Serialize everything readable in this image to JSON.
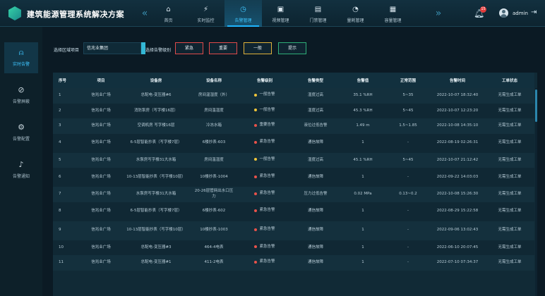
{
  "app": {
    "title": "建筑能源管理系统解决方案"
  },
  "nav": {
    "prev_icon": "double-chevron-left-icon",
    "next_icon": "double-chevron-right-icon",
    "items": [
      {
        "label": "首页",
        "icon": "home-icon",
        "glyph": "⌂",
        "active": false
      },
      {
        "label": "实时监控",
        "icon": "pulse-icon",
        "glyph": "⚡",
        "active": false
      },
      {
        "label": "告警管理",
        "icon": "alarm-icon",
        "glyph": "◷",
        "active": true
      },
      {
        "label": "视频管理",
        "icon": "video-icon",
        "glyph": "▣",
        "active": false
      },
      {
        "label": "门禁管理",
        "icon": "door-icon",
        "glyph": "▤",
        "active": false
      },
      {
        "label": "量耗管理",
        "icon": "gauge-icon",
        "glyph": "◔",
        "active": false
      },
      {
        "label": "容量管理",
        "icon": "calendar-icon",
        "glyph": "▦",
        "active": false
      }
    ]
  },
  "header": {
    "notification_count": "15",
    "user_name": "admin"
  },
  "sidebar": {
    "items": [
      {
        "label": "实时告警",
        "icon": "alarm-bell-icon",
        "glyph": "⍝",
        "active": true
      },
      {
        "label": "告警屏蔽",
        "icon": "shield-mute-icon",
        "glyph": "⊘",
        "active": false
      },
      {
        "label": "告警配置",
        "icon": "settings-icon",
        "glyph": "⚙",
        "active": false
      },
      {
        "label": "告警通知",
        "icon": "speaker-icon",
        "glyph": "♪",
        "active": false
      }
    ]
  },
  "filters": {
    "area_label": "选择区域项目",
    "area_value": "信兆业集团",
    "level_label": "选择告警级别",
    "levels": [
      {
        "label": "紧急",
        "color": "#e04a4a"
      },
      {
        "label": "重要",
        "color": "#e04a4a"
      },
      {
        "label": "一般",
        "color": "#e0b23a"
      },
      {
        "label": "提示",
        "color": "#2fae78"
      }
    ]
  },
  "table": {
    "headers": [
      "序号",
      "项目",
      "设备房",
      "设备名称",
      "告警级别",
      "告警类型",
      "告警值",
      "正常范围",
      "告警时间",
      "工单状态"
    ],
    "rows": [
      {
        "no": "1",
        "project": "信兆业广场",
        "room": "总配电-变压器#6",
        "device": "房间温湿度（外）",
        "level": "一般告警",
        "level_color": "#f0c43a",
        "type": "湿度过高",
        "value": "35.1 %RH",
        "range": "5~35",
        "time": "2022-10-07 18:32:40",
        "status": "无需生成工单",
        "tall": false
      },
      {
        "no": "2",
        "project": "信兆业广场",
        "room": "消防泵房（写字楼16层）",
        "device": "房间温湿度",
        "level": "一般告警",
        "level_color": "#f0c43a",
        "type": "湿度过高",
        "value": "45.3 %RH",
        "range": "5~45",
        "time": "2022-10-07 12:23:20",
        "status": "无需生成工单",
        "tall": false
      },
      {
        "no": "3",
        "project": "信兆业广场",
        "room": "空调机房 写字楼16层",
        "device": "冷冻水箱",
        "level": "重要告警",
        "level_color": "#e8524a",
        "type": "液位过低告警",
        "value": "1.49 m",
        "range": "1.5~1.85",
        "time": "2022-10-08 14:35:10",
        "status": "无需生成工单",
        "tall": false
      },
      {
        "no": "4",
        "project": "信兆业广场",
        "room": "6-5层智能抄表（写字楼7层）",
        "device": "6楼抄表-603",
        "level": "紧急告警",
        "level_color": "#e8524a",
        "type": "通信故障",
        "value": "1",
        "range": "-",
        "time": "2022-08-19 02:26:31",
        "status": "无需生成工单",
        "tall": true
      },
      {
        "no": "5",
        "project": "信兆业广场",
        "room": "水泵房写字楼31大水箱",
        "device": "房间温湿度",
        "level": "一般告警",
        "level_color": "#f0c43a",
        "type": "湿度过高",
        "value": "45.1 %RH",
        "range": "5~45",
        "time": "2022-10-07 21:12:42",
        "status": "无需生成工单",
        "tall": false
      },
      {
        "no": "6",
        "project": "信兆业广场",
        "room": "10-13层智能抄表（写字楼10层）",
        "device": "10楼抄表-1004",
        "level": "紧急告警",
        "level_color": "#e8524a",
        "type": "通信故障",
        "value": "1",
        "range": "-",
        "time": "2022-09-22 14:03:03",
        "status": "无需生成工单",
        "tall": true
      },
      {
        "no": "7",
        "project": "信兆业广场",
        "room": "水泵房写字楼31大水箱",
        "device": "20-26层管网出水口压力",
        "level": "紧急告警",
        "level_color": "#e8524a",
        "type": "压力过低告警",
        "value": "0.02 MPa",
        "range": "0.13~0.2",
        "time": "2022-10-08 15:26:30",
        "status": "无需生成工单",
        "tall": false
      },
      {
        "no": "8",
        "project": "信兆业广场",
        "room": "6-5层智能抄表（写字楼7层）",
        "device": "6楼抄表-602",
        "level": "紧急告警",
        "level_color": "#e8524a",
        "type": "通信故障",
        "value": "1",
        "range": "-",
        "time": "2022-08-29 15:22:58",
        "status": "无需生成工单",
        "tall": true
      },
      {
        "no": "9",
        "project": "信兆业广场",
        "room": "10-13层智能抄表（写字楼10层）",
        "device": "10楼抄表-1003",
        "level": "紧急告警",
        "level_color": "#e8524a",
        "type": "通信故障",
        "value": "1",
        "range": "-",
        "time": "2022-09-06 13:02:43",
        "status": "无需生成工单",
        "tall": true
      },
      {
        "no": "10",
        "project": "信兆业广场",
        "room": "总配电-变压器#3",
        "device": "464-4电表",
        "level": "紧急告警",
        "level_color": "#e8524a",
        "type": "通信故障",
        "value": "1",
        "range": "-",
        "time": "2022-06-10 20:07:45",
        "status": "无需生成工单",
        "tall": false
      },
      {
        "no": "11",
        "project": "信兆业广场",
        "room": "总配电-变压器#1",
        "device": "411-2电表",
        "level": "紧急告警",
        "level_color": "#e8524a",
        "type": "通信故障",
        "value": "1",
        "range": "-",
        "time": "2022-07-10 07:34:37",
        "status": "无需生成工单",
        "tall": false
      }
    ]
  },
  "colors": {
    "accent": "#1fb6ff",
    "background": "#0b1a24",
    "panel": "#112a36"
  }
}
